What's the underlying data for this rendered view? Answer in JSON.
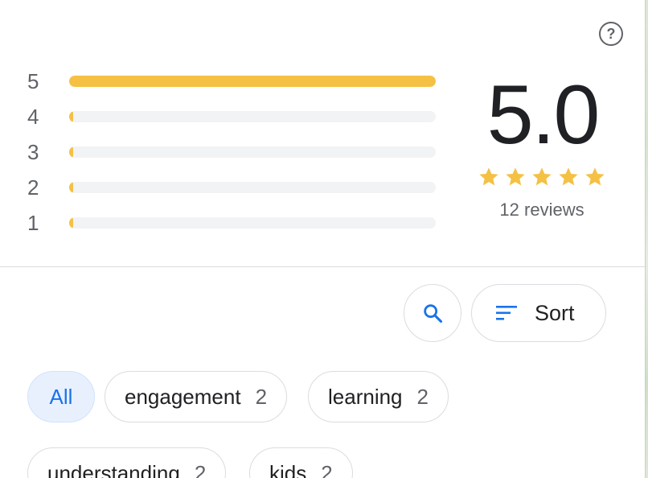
{
  "help": {
    "icon": "help-circle-icon",
    "glyph": "?"
  },
  "histogram": [
    {
      "label": "5",
      "fraction": 1.0
    },
    {
      "label": "4",
      "fraction": 0.01
    },
    {
      "label": "3",
      "fraction": 0.01
    },
    {
      "label": "2",
      "fraction": 0.01
    },
    {
      "label": "1",
      "fraction": 0.01
    }
  ],
  "summary": {
    "rating": "5.0",
    "stars_filled": 5,
    "reviews": "12 reviews"
  },
  "toolbar": {
    "search_icon": "search-icon",
    "sort_icon": "sort-icon",
    "sort_label": "Sort"
  },
  "chips": [
    {
      "label": "All",
      "count": "",
      "active": true
    },
    {
      "label": "engagement",
      "count": "2",
      "active": false
    },
    {
      "label": "learning",
      "count": "2",
      "active": false
    },
    {
      "label": "understanding",
      "count": "2",
      "active": false
    },
    {
      "label": "kids",
      "count": "2",
      "active": false
    }
  ],
  "colors": {
    "star": "#f4c144",
    "accent": "#1a73e8",
    "active_chip_bg": "#e8f0fe"
  }
}
